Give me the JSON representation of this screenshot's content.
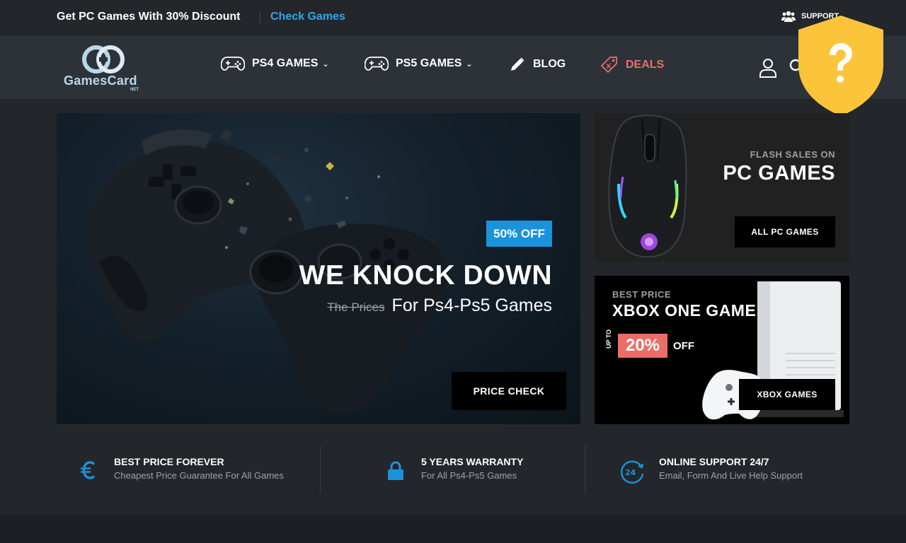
{
  "topbar": {
    "promo": "Get PC Games With 30% Discount",
    "promo_link": "Check Games",
    "support": "SUPPORT"
  },
  "logo": {
    "name": "GamesCard",
    "suffix": "NET"
  },
  "nav": {
    "items": [
      {
        "label": "PS4 GAMES",
        "icon": "gamepad-icon",
        "dropdown": true
      },
      {
        "label": "PS5 GAMES",
        "icon": "gamepad-icon",
        "dropdown": true
      },
      {
        "label": "BLOG",
        "icon": "pencil-icon",
        "dropdown": false
      },
      {
        "label": "DEALS",
        "icon": "tag-icon",
        "dropdown": false,
        "color": "#ec6d67"
      }
    ]
  },
  "hero": {
    "badge": "50% OFF",
    "title": "WE KNOCK DOWN",
    "strike": "The Prices",
    "subtitle": "For Ps4-Ps5 Games",
    "button": "PRICE CHECK"
  },
  "banner_pc": {
    "label": "FLASH SALES ON",
    "title": "PC GAMES",
    "button": "ALL PC GAMES"
  },
  "banner_xbox": {
    "label": "BEST PRICE",
    "title": "XBOX ONE GAME",
    "upto": "UP TO",
    "percent": "20%",
    "off": "OFF",
    "button": "XBOX GAMES"
  },
  "features": [
    {
      "icon": "euro-icon",
      "title": "BEST PRICE FOREVER",
      "desc": "Cheapest Price Guarantee For All Games"
    },
    {
      "icon": "lock-icon",
      "title": "5 YEARS WARRANTY",
      "desc": "For All Ps4-Ps5 Games"
    },
    {
      "icon": "support-24-icon",
      "title": "ONLINE SUPPORT 24/7",
      "desc": "Email, Form And Live Help Support"
    }
  ],
  "colors": {
    "accent_blue": "#2ea8e6",
    "badge_blue": "#1a93dc",
    "deal_red": "#ec6d67",
    "shield_yellow": "#fcc43a"
  }
}
